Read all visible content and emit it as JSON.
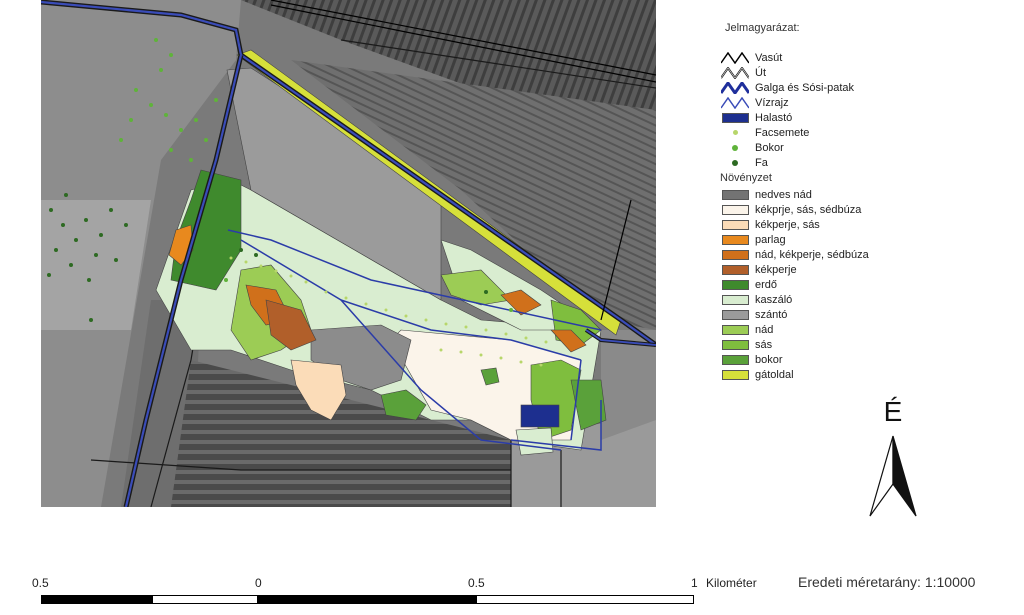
{
  "legend": {
    "title": "Jelmagyarázat:",
    "line_items": [
      {
        "label": "Vasút",
        "icon": "railway-line-icon",
        "color": "#000000"
      },
      {
        "label": "Út",
        "icon": "road-line-icon",
        "color": "#1a1a1a"
      },
      {
        "label": "Galga és Sósi-patak",
        "icon": "stream-line-icon",
        "color": "#1f2f9c"
      },
      {
        "label": "Vízrajz",
        "icon": "hydrography-line-icon",
        "color": "#3a4cb8"
      }
    ],
    "area_items": [
      {
        "label": "Halastó",
        "color": "#1d2f8f"
      }
    ],
    "point_items": [
      {
        "label": "Facsemete",
        "color": "#b7d66a"
      },
      {
        "label": "Bokor",
        "color": "#5fb33a"
      },
      {
        "label": "Fa",
        "color": "#2d6a22"
      }
    ],
    "vegetation_title": "Növényzet",
    "vegetation": [
      {
        "label": "nedves nád",
        "color": "#737373"
      },
      {
        "label": "kékprje, sás, sédbúza",
        "color": "#fbf4ea"
      },
      {
        "label": "kékperje, sás",
        "color": "#fbdcb8"
      },
      {
        "label": "parlag",
        "color": "#e8891e"
      },
      {
        "label": "nád, kékperje, sédbúza",
        "color": "#d0701b"
      },
      {
        "label": "kékperje",
        "color": "#b15f2a"
      },
      {
        "label": "erdő",
        "color": "#3f8a2d"
      },
      {
        "label": "kaszáló",
        "color": "#d9edd0"
      },
      {
        "label": "szántó",
        "color": "#9b9b9b"
      },
      {
        "label": "nád",
        "color": "#9ccc55"
      },
      {
        "label": "sás",
        "color": "#7fbe3e"
      },
      {
        "label": "bokor",
        "color": "#5aa13a"
      },
      {
        "label": "gátoldal",
        "color": "#d6e03a"
      }
    ]
  },
  "north_arrow": {
    "letter": "É"
  },
  "scale_bar": {
    "labels": [
      "0.5",
      "0",
      "0.5",
      "1"
    ],
    "unit": "Kilométer"
  },
  "scale_ratio": "Eredeti méretarány: 1:10000"
}
